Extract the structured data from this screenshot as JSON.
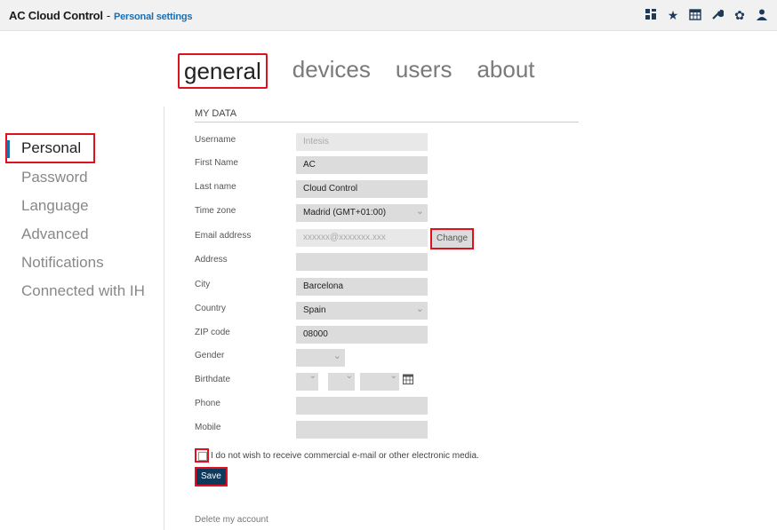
{
  "header": {
    "app_title": "AC Cloud Control",
    "separator": "-",
    "page_name": "Personal settings",
    "icons": [
      "dashboard-icon",
      "star-icon",
      "calendar-icon",
      "wrench-icon",
      "gear-icon",
      "user-icon"
    ]
  },
  "tabs": [
    {
      "label": "general",
      "active": true
    },
    {
      "label": "devices",
      "active": false
    },
    {
      "label": "users",
      "active": false
    },
    {
      "label": "about",
      "active": false
    }
  ],
  "sidebar": {
    "items": [
      {
        "label": "Personal",
        "active": true
      },
      {
        "label": "Password"
      },
      {
        "label": "Language"
      },
      {
        "label": "Advanced"
      },
      {
        "label": "Notifications"
      },
      {
        "label": "Connected with IH"
      }
    ]
  },
  "form": {
    "section_title": "MY DATA",
    "fields": {
      "username": {
        "label": "Username",
        "value": "Intesis"
      },
      "first_name": {
        "label": "First Name",
        "value": "AC"
      },
      "last_name": {
        "label": "Last name",
        "value": "Cloud Control"
      },
      "time_zone": {
        "label": "Time zone",
        "value": "Madrid (GMT+01:00)"
      },
      "email": {
        "label": "Email address",
        "value": "xxxxxx@xxxxxxx.xxx"
      },
      "address": {
        "label": "Address",
        "value": ""
      },
      "city": {
        "label": "City",
        "value": "Barcelona"
      },
      "country": {
        "label": "Country",
        "value": "Spain"
      },
      "zip": {
        "label": "ZIP code",
        "value": "08000"
      },
      "gender": {
        "label": "Gender",
        "value": ""
      },
      "birthdate": {
        "label": "Birthdate",
        "value": ""
      },
      "phone": {
        "label": "Phone",
        "value": ""
      },
      "mobile": {
        "label": "Mobile",
        "value": ""
      }
    },
    "change_label": "Change",
    "optout_text": "I do not wish to receive commercial e-mail or other electronic media.",
    "save_label": "Save",
    "delete_label": "Delete my account"
  },
  "colors": {
    "highlight": "#e0101f",
    "accent": "#1b6fb0",
    "save_bg": "#0e3a5e"
  }
}
